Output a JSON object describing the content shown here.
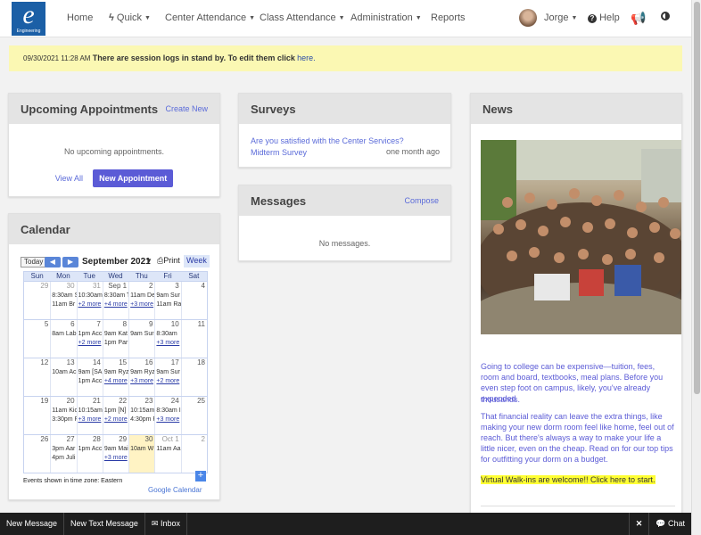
{
  "nav": {
    "logo_text": "Engineering",
    "items": [
      {
        "label": "Home",
        "has_caret": false
      },
      {
        "label": "Quick",
        "has_caret": true,
        "icon": "bolt-icon"
      },
      {
        "label": "Center Attendance",
        "has_caret": true
      },
      {
        "label": "Class Attendance",
        "has_caret": true
      },
      {
        "label": "Administration",
        "has_caret": true
      },
      {
        "label": "Reports",
        "has_caret": false
      }
    ],
    "user": "Jorge",
    "help": "Help"
  },
  "alert": {
    "timestamp": "09/30/2021 11:28 AM",
    "message": "There are session logs in stand by. To edit them click",
    "link": "here."
  },
  "appointments": {
    "title": "Upcoming Appointments",
    "create_link": "Create New",
    "empty": "No upcoming appointments.",
    "view_all": "View All",
    "new_button": "New Appointment"
  },
  "surveys": {
    "title": "Surveys",
    "item_text": "Are you satisfied with the Center Services? Midterm Survey",
    "item_time": "one month ago"
  },
  "messages": {
    "title": "Messages",
    "compose": "Compose",
    "empty": "No messages."
  },
  "calendar": {
    "title": "Calendar",
    "today": "Today",
    "month": "September 2021",
    "print": "Print",
    "view": "Week",
    "dow": [
      "Sun",
      "Mon",
      "Tue",
      "Wed",
      "Thu",
      "Fri",
      "Sat"
    ],
    "weeks": [
      [
        {
          "n": "29",
          "other": true,
          "ev": [],
          "more": ""
        },
        {
          "n": "30",
          "other": true,
          "ev": [
            "8:30am S",
            "11am Br"
          ],
          "more": ""
        },
        {
          "n": "31",
          "other": true,
          "ev": [
            "10:30am",
            ""
          ],
          "more": "+2 more"
        },
        {
          "n": "Sep 1",
          "other": false,
          "ev": [
            "8:30am T",
            ""
          ],
          "more": "+4 more"
        },
        {
          "n": "2",
          "other": false,
          "ev": [
            "11am De",
            ""
          ],
          "more": "+3 more"
        },
        {
          "n": "3",
          "other": false,
          "ev": [
            "9am Sur",
            "11am Ra"
          ],
          "more": ""
        },
        {
          "n": "4",
          "other": false,
          "ev": [],
          "more": ""
        }
      ],
      [
        {
          "n": "5",
          "other": false,
          "ev": [],
          "more": ""
        },
        {
          "n": "6",
          "other": false,
          "ev": [
            "8am Lab"
          ],
          "more": ""
        },
        {
          "n": "7",
          "other": false,
          "ev": [
            "1pm Acc"
          ],
          "more": "+2 more"
        },
        {
          "n": "8",
          "other": false,
          "ev": [
            "9am Kat",
            "1pm Par"
          ],
          "more": ""
        },
        {
          "n": "9",
          "other": false,
          "ev": [
            "9am Sur"
          ],
          "more": ""
        },
        {
          "n": "10",
          "other": false,
          "ev": [
            "8:30am"
          ],
          "more": "+3 more"
        },
        {
          "n": "11",
          "other": false,
          "ev": [],
          "more": ""
        }
      ],
      [
        {
          "n": "12",
          "other": false,
          "ev": [],
          "more": ""
        },
        {
          "n": "13",
          "other": false,
          "ev": [
            "10am Ac"
          ],
          "more": ""
        },
        {
          "n": "14",
          "other": false,
          "ev": [
            "9am [SA",
            "1pm Acc"
          ],
          "more": ""
        },
        {
          "n": "15",
          "other": false,
          "ev": [
            "9am Ryz"
          ],
          "more": "+4 more"
        },
        {
          "n": "16",
          "other": false,
          "ev": [
            "9am Ryz"
          ],
          "more": "+3 more"
        },
        {
          "n": "17",
          "other": false,
          "ev": [
            "9am Sur"
          ],
          "more": "+2 more"
        },
        {
          "n": "18",
          "other": false,
          "ev": [],
          "more": ""
        }
      ],
      [
        {
          "n": "19",
          "other": false,
          "ev": [],
          "more": ""
        },
        {
          "n": "20",
          "other": false,
          "ev": [
            "11am Kic",
            "3:30pm F"
          ],
          "more": ""
        },
        {
          "n": "21",
          "other": false,
          "ev": [
            "10:15am"
          ],
          "more": "+3 more"
        },
        {
          "n": "22",
          "other": false,
          "ev": [
            "1pm [N]"
          ],
          "more": "+2 more"
        },
        {
          "n": "23",
          "other": false,
          "ev": [
            "10:15am",
            "4:30pm F"
          ],
          "more": ""
        },
        {
          "n": "24",
          "other": false,
          "ev": [
            "8:30am I"
          ],
          "more": "+3 more"
        },
        {
          "n": "25",
          "other": false,
          "ev": [],
          "more": ""
        }
      ],
      [
        {
          "n": "26",
          "other": false,
          "ev": [],
          "more": ""
        },
        {
          "n": "27",
          "other": false,
          "ev": [
            "3pm Aar",
            "4pm Juli"
          ],
          "more": ""
        },
        {
          "n": "28",
          "other": false,
          "ev": [
            "1pm Acc"
          ],
          "more": ""
        },
        {
          "n": "29",
          "other": false,
          "ev": [
            "9am Mai"
          ],
          "more": "+3 more"
        },
        {
          "n": "30",
          "other": false,
          "today": true,
          "ev": [
            "10am W"
          ],
          "more": ""
        },
        {
          "n": "Oct 1",
          "other": true,
          "ev": [
            "11am Aa"
          ],
          "more": ""
        },
        {
          "n": "2",
          "other": true,
          "ev": [],
          "more": ""
        }
      ]
    ],
    "footer": "Events shown in time zone: Eastern",
    "gcal": "Google Calendar"
  },
  "news": {
    "title": "News",
    "para1": "Going to college can be expensive—tuition, fees, room and board, textbooks, meal plans. Before you even step foot on campus, likely, you've already expended",
    "para1b": "thousands.",
    "para2": "That financial reality can leave the extra things, like making your new dorm room feel like home, feel out of reach. But there's always a way to make your life a little nicer, even on the cheap. Read on for our top tips for outfitting your dorm on a budget.",
    "walkin": "Virtual Walk-ins are welcome!! Click here to start."
  },
  "bottombar": {
    "new_message": "New Message",
    "new_text": "New Text Message",
    "inbox": "Inbox",
    "chat": "Chat"
  },
  "colors": {
    "accent": "#5b5bd6",
    "alert_bg": "#fbf8b3",
    "today": "#fff3c4"
  }
}
